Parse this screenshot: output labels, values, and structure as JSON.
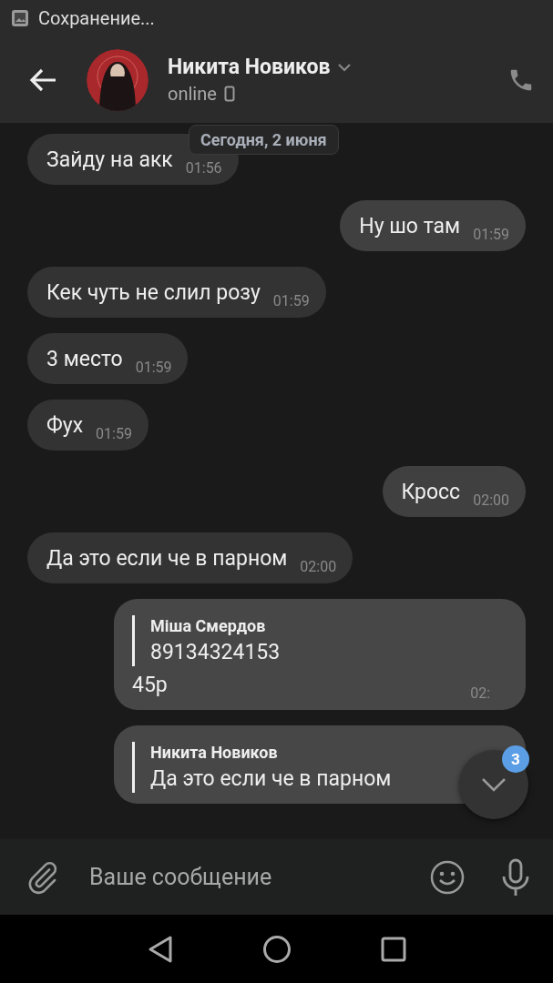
{
  "status_bar": {
    "text": "Сохранение..."
  },
  "header": {
    "name": "Никита Новиков",
    "status": "online"
  },
  "date_label": "Сегодня, 2 июня",
  "messages": [
    {
      "kind": "text",
      "outgoing": false,
      "text": "Зайду на акк",
      "time": "01:56"
    },
    {
      "kind": "text",
      "outgoing": true,
      "text": "Ну шо там",
      "time": "01:59"
    },
    {
      "kind": "text",
      "outgoing": false,
      "text": "Кек чуть не слил розу",
      "time": "01:59"
    },
    {
      "kind": "text",
      "outgoing": false,
      "text": "3 место",
      "time": "01:59"
    },
    {
      "kind": "text",
      "outgoing": false,
      "text": "Фух",
      "time": "01:59"
    },
    {
      "kind": "text",
      "outgoing": true,
      "text": "Кросс",
      "time": "02:00"
    },
    {
      "kind": "text",
      "outgoing": false,
      "text": "Да это если че в парном",
      "time": "02:00"
    },
    {
      "kind": "forward",
      "outgoing": true,
      "sender": "Міша Смердов",
      "quote": "89134324153",
      "text": "45р",
      "time": "02:"
    },
    {
      "kind": "forward",
      "outgoing": true,
      "sender": "Никита Новиков",
      "quote": "Да это если че в парном"
    }
  ],
  "scroll_button": {
    "badge": "3"
  },
  "composer": {
    "placeholder": "Ваше сообщение"
  }
}
